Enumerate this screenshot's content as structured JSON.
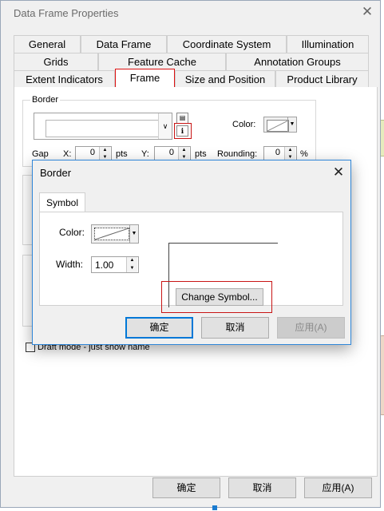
{
  "main": {
    "title": "Data Frame Properties",
    "close_glyph": "✕",
    "tabs_row1": [
      "General",
      "Data Frame",
      "Coordinate System",
      "Illumination"
    ],
    "tabs_row2": [
      "Grids",
      "Feature Cache",
      "Annotation Groups"
    ],
    "tabs_row3": [
      "Extent Indicators",
      "Frame",
      "Size and Position",
      "Product Library"
    ],
    "border_group_label": "Border",
    "color_label": "Color:",
    "gap_label": "Gap",
    "x_label": "X:",
    "x_value": "0",
    "y_label": "Y:",
    "y_value": "0",
    "pts_label": "pts",
    "rounding_label": "Rounding:",
    "rounding_value": "0",
    "percent_label": "%",
    "draft_mode_label": "Draft mode - just show name",
    "ok_label": "确定",
    "cancel_label": "取消",
    "apply_label": "应用(A)"
  },
  "border_dialog": {
    "title": "Border",
    "close_glyph": "✕",
    "tab_label": "Symbol",
    "color_label": "Color:",
    "width_label": "Width:",
    "width_value": "1.00",
    "change_symbol_label": "Change Symbol...",
    "ok_label": "确定",
    "cancel_label": "取消",
    "apply_label": "应用(A)"
  },
  "colors": {
    "accent_blue": "#0078d7",
    "highlight_red": "#c81414",
    "dialog_bg": "#f0f0f0"
  }
}
